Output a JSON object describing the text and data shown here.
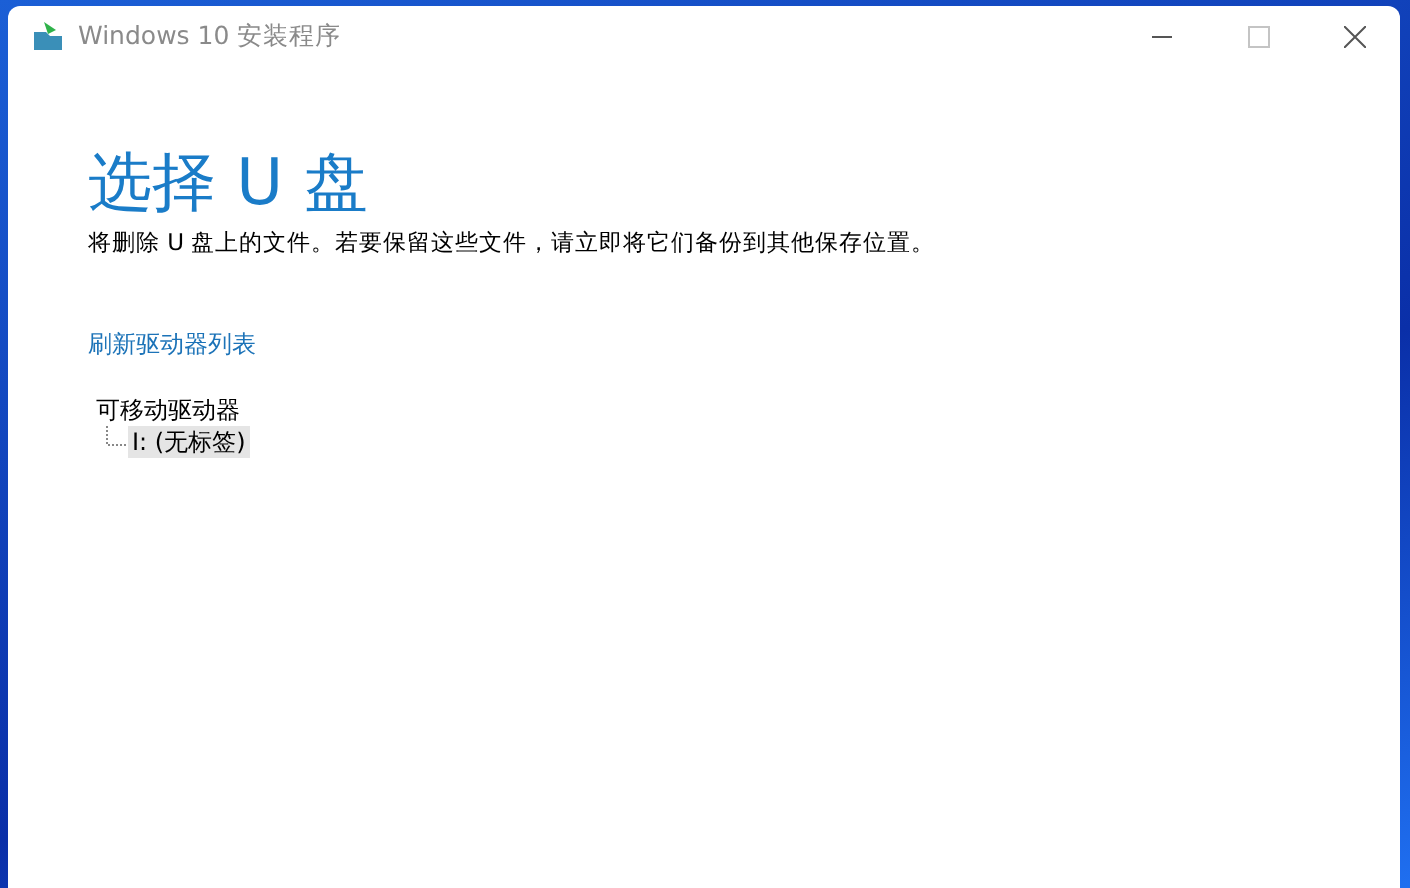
{
  "window": {
    "title": "Windows 10 安装程序"
  },
  "heading": "选择 U 盘",
  "description": "将删除 U 盘上的文件。若要保留这些文件，请立即将它们备份到其他保存位置。",
  "refresh_link": "刷新驱动器列表",
  "drive_tree": [
    {
      "label": "可移动驱动器",
      "selected": false,
      "expanded": true,
      "children": [
        {
          "label": "I: (无标签)",
          "selected": true
        }
      ]
    }
  ]
}
